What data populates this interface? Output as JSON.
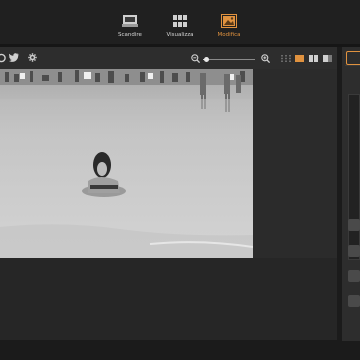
{
  "modes": {
    "scan_label": "Scandire",
    "view_label": "Visualizza",
    "edit_label": "Modifica"
  },
  "colors": {
    "accent": "#e0923f",
    "toolbar_bg": "#2d2d2d",
    "canvas_bg": "#2b2b2b"
  },
  "toolbar": {
    "icons": [
      "share-icon",
      "twitter-icon",
      "gear-icon",
      "zoom-out-icon",
      "zoom-slider",
      "zoom-in-icon",
      "grid-view-icon",
      "single-view-icon",
      "split-view-icon",
      "compare-view-icon"
    ],
    "zoom_level": 0.05
  },
  "photo": {
    "description_icon": "beach-photo"
  }
}
